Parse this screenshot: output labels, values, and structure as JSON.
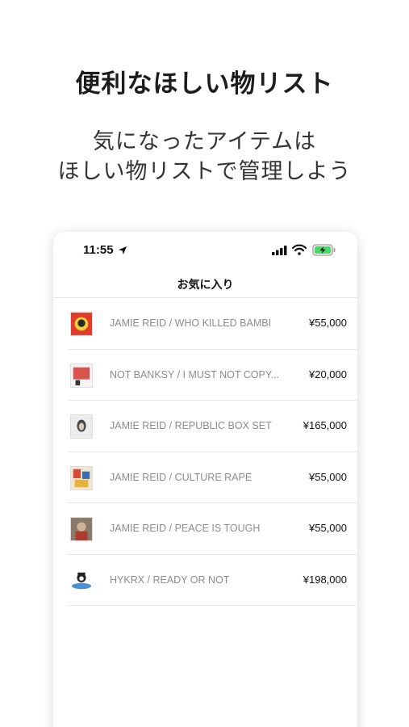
{
  "promo": {
    "headline": "便利なほしい物リスト",
    "subline_1": "気になったアイテムは",
    "subline_2": "ほしい物リストで管理しよう"
  },
  "status_bar": {
    "time": "11:55",
    "icons": [
      "location-arrow-icon",
      "cellular-signal-icon",
      "wifi-icon",
      "battery-charging-icon"
    ],
    "battery_color": "#4cd964"
  },
  "nav": {
    "title": "お気に入り"
  },
  "favorites": {
    "items": [
      {
        "name": "JAMIE REID / WHO KILLED BAMBI",
        "price": "¥55,000",
        "thumb": "artwork-thumbnail"
      },
      {
        "name": "NOT BANKSY / I MUST NOT COPY...",
        "price": "¥20,000",
        "thumb": "artwork-thumbnail"
      },
      {
        "name": "JAMIE REID / REPUBLIC BOX SET",
        "price": "¥165,000",
        "thumb": "artwork-thumbnail"
      },
      {
        "name": "JAMIE REID / CULTURE RAPE",
        "price": "¥55,000",
        "thumb": "artwork-thumbnail"
      },
      {
        "name": "JAMIE REID / PEACE IS TOUGH",
        "price": "¥55,000",
        "thumb": "artwork-thumbnail"
      },
      {
        "name": "HYKRX / READY OR NOT",
        "price": "¥198,000",
        "thumb": "artwork-thumbnail"
      }
    ]
  }
}
